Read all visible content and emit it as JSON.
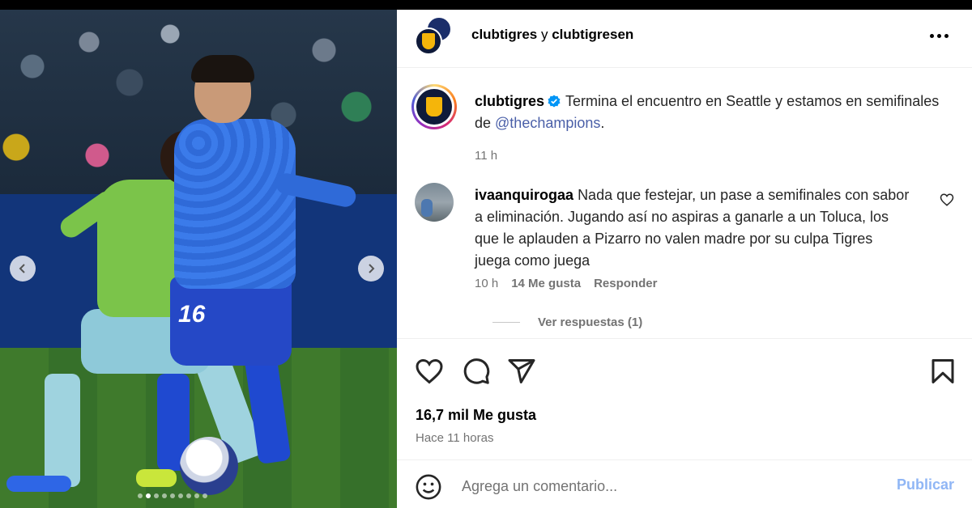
{
  "header": {
    "user1": "clubtigres",
    "connector": "y",
    "user2": "clubtigresen",
    "more_icon": "more-horizontal-icon"
  },
  "media": {
    "prev_icon": "chevron-left-icon",
    "next_icon": "chevron-right-icon",
    "slide_count": 9,
    "active_slide": 2,
    "jersey_number": "16"
  },
  "caption": {
    "username": "clubtigres",
    "text_before": "Termina el encuentro en Seattle y estamos en semifinales de ",
    "mention": "@thechampions",
    "text_after": ".",
    "time": "11 h"
  },
  "comment": {
    "username": "ivaanquirogaa",
    "text": "Nada que festejar, un pase a semifinales con sabor a eliminación. Jugando así no aspiras a ganarle a un Toluca, los que le aplauden a Pizarro no valen madre por su culpa Tigres juega como juega",
    "time": "10 h",
    "likes": "14 Me gusta",
    "reply": "Responder",
    "view_replies": "Ver respuestas (1)"
  },
  "post": {
    "likes": "16,7 mil Me gusta",
    "when": "Hace 11 horas"
  },
  "composer": {
    "placeholder": "Agrega un comentario...",
    "publish": "Publicar"
  },
  "colors": {
    "mention": "#4a5fa8",
    "muted": "#737373",
    "publish": "#90b6f5",
    "verified": "#0095f6"
  }
}
